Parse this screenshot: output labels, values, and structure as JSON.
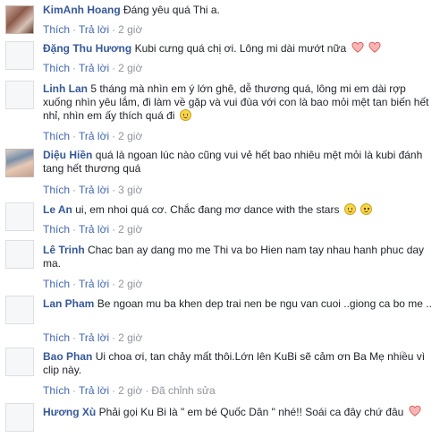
{
  "comments": [
    {
      "name": "KimAnh Hoang",
      "text": "Đáng yêu quá Thi a.",
      "like": "Thích",
      "reply": "Trả lời",
      "time": "2 giờ",
      "edited": ""
    },
    {
      "name": "Đặng Thu Hương",
      "text": "Kubi cưng quá chị ơi. Lông mi dài mướt nữa",
      "like": "Thích",
      "reply": "Trả lời",
      "time": "2 giờ",
      "edited": ""
    },
    {
      "name": "Linh Lan",
      "text": "5 tháng mà nhìn em ý lớn ghê, dễ thương quá, lông mi em dài rợp xuống nhìn yêu lắm, đi làm về gặp và vui đùa với con là bao mỏi mệt tan biến hết nhỉ, nhìn em ấy thích quá đi",
      "like": "Thích",
      "reply": "Trả lời",
      "time": "2 giờ",
      "edited": ""
    },
    {
      "name": "Diệu Hiền",
      "text": "quá là ngoan lúc nào cũng vui vẻ hết bao nhiêu mệt mỏi là kubi đánh tang hết thương quá",
      "like": "Thích",
      "reply": "Trả lời",
      "time": "3 giờ",
      "edited": ""
    },
    {
      "name": "Le An",
      "text": "ui, em nhoi quá cơ. Chắc đang mơ dance with the stars",
      "like": "Thích",
      "reply": "Trả lời",
      "time": "2 giờ",
      "edited": ""
    },
    {
      "name": "Lê Trinh",
      "text": "Chac ban ay dang mo me Thi va bo Hien nam tay nhau hanh phuc day ma.",
      "like": "Thích",
      "reply": "Trả lời",
      "time": "2 giờ",
      "edited": ""
    },
    {
      "name": "Lan Pham",
      "text": "Be ngoan mu ba khen dep trai nen be ngu van cuoi ..giong ca bo me ..",
      "like": "Thích",
      "reply": "Trả lời",
      "time": "2 giờ",
      "edited": ""
    },
    {
      "name": "Bao Phan",
      "text": "Ui choa ơi, tan chảy mất thôi.Lớn lên KuBi sẽ cảm ơn Ba Mẹ nhiều vì clip này.",
      "like": "Thích",
      "reply": "Trả lời",
      "time": "2 giờ",
      "edited": "Đã chỉnh sửa"
    },
    {
      "name": "Hương Xù",
      "text": "Phải gọi Ku Bi là \" em bé Quốc Dân \" nhé!! Soái ca đây chứ đâu",
      "like": "Thích",
      "reply": "Trả lời",
      "time": "2 giờ",
      "edited": ""
    }
  ],
  "icons": {
    "smile": "smile-emoticon-icon",
    "heart": "heart-emoticon-icon"
  }
}
